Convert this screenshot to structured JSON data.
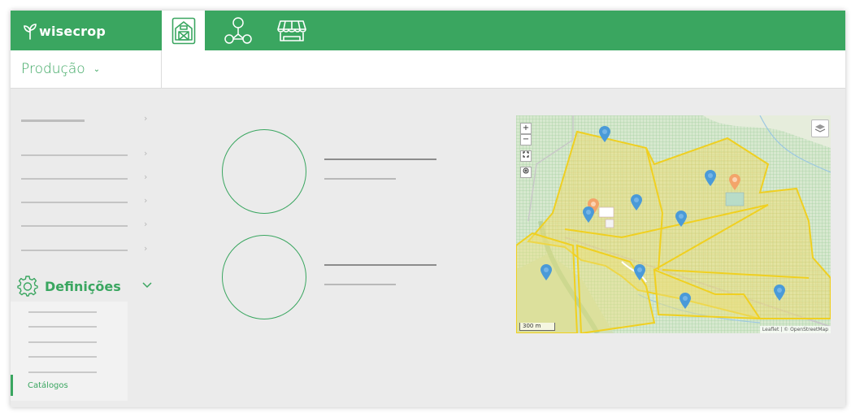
{
  "app": {
    "brand": "wisecrop",
    "brand_color": "#3aa660",
    "nav": [
      {
        "icon": "farm-barn-icon",
        "active": true
      },
      {
        "icon": "network-nodes-icon",
        "active": false
      },
      {
        "icon": "market-stall-icon",
        "active": false
      }
    ]
  },
  "module": {
    "label": "Produção",
    "chevron": "⌄"
  },
  "sidebar": {
    "settings_label": "Definições",
    "settings_icon": "gear-icon",
    "chevron_right": "›",
    "chevron_down": "⌄",
    "active_item": "Catálogos"
  },
  "map": {
    "zoom_in": "+",
    "zoom_out": "−",
    "scale_label": "300 m",
    "attribution": "Leaflet | © OpenStreetMap"
  }
}
